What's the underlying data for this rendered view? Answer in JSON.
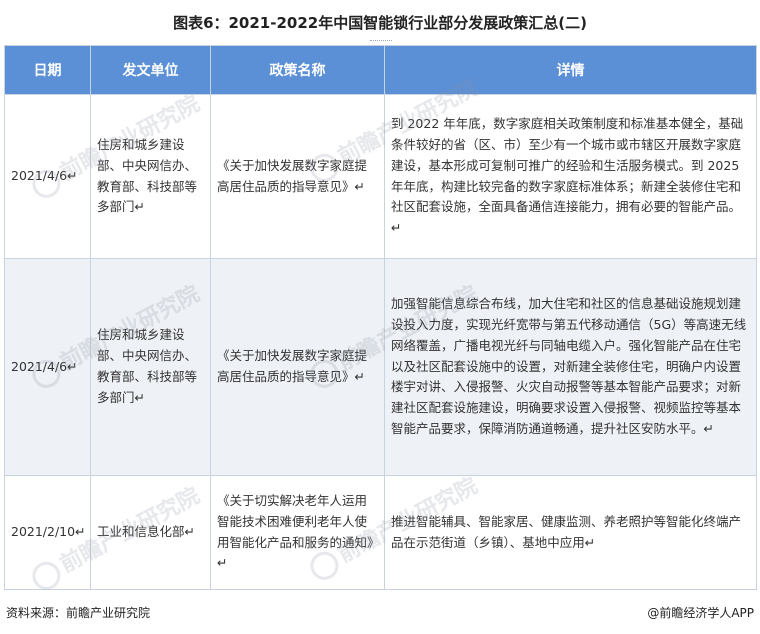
{
  "title": "图表6：2021-2022年中国智能锁行业部分发展政策汇总(二)",
  "table": {
    "headers": {
      "date": "日期",
      "dept": "发文单位",
      "name": "政策名称",
      "detail": "详情"
    },
    "rows": [
      {
        "date": "2021/4/6↵",
        "dept": "住房和城乡建设部、中央网信办、教育部、科技部等多部门↵",
        "name": "《关于加快发展数字家庭提高居住品质的指导意见》↵",
        "detail": "到 2022 年年底，数字家庭相关政策制度和标准基本健全，基础条件较好的省（区、市）至少有一个城市或市辖区开展数字家庭建设，基本形成可复制可推广的经验和生活服务模式。到 2025 年年底，构建比较完备的数字家庭标准体系；新建全装修住宅和社区配套设施，全面具备通信连接能力，拥有必要的智能产品。↵"
      },
      {
        "date": "2021/4/6↵",
        "dept": "住房和城乡建设部、中央网信办、教育部、科技部等多部门↵",
        "name": "《关于加快发展数字家庭提高居住品质的指导意见》↵",
        "detail": "加强智能信息综合布线，加大住宅和社区的信息基础设施规划建设投入力度，实现光纤宽带与第五代移动通信（5G）等高速无线网络覆盖，广播电视光纤与同轴电缆入户。强化智能产品在住宅以及社区配套设施中的设置，对新建全装修住宅，明确户内设置楼宇对讲、入侵报警、火灾自动报警等基本智能产品要求；对新建社区配套设施建设，明确要求设置入侵报警、视频监控等基本智能产品要求，保障消防通道畅通，提升社区安防水平。↵"
      },
      {
        "date": "2021/2/10↵",
        "dept": "工业和信息化部↵",
        "name": "《关于切实解决老年人运用智能技术困难便利老年人使用智能化产品和服务的通知》↵",
        "detail": "推进智能辅具、智能家居、健康监测、养老照护等智能化终端产品在示范街道（乡镇）、基地中应用↵"
      }
    ]
  },
  "footer": {
    "source": "资料来源：前瞻产业研究院",
    "brand": "@前瞻经济学人APP"
  },
  "watermark": "前瞻产业研究院"
}
